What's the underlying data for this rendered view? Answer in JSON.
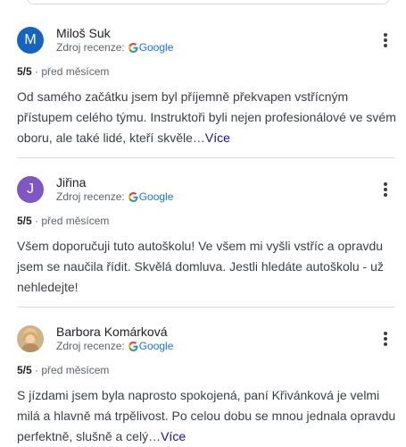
{
  "reviews": [
    {
      "name": "Miloš Suk",
      "avatar_letter": "M",
      "avatar_color": "#1565c0",
      "source_label": "Zdroj recenze:",
      "source_name": "Google",
      "rating": "5/5",
      "separator": "·",
      "time": "před měsícem",
      "text": "Od samého začátku jsem byl příjemně překvapen vstřícným přístupem celého týmu. Instruktoři byli nejen profesionálové ve svém oboru, ale také lidé, kteří skvěle…",
      "more": "Více"
    },
    {
      "name": "Jiřina",
      "avatar_letter": "J",
      "avatar_color": "#7e57c2",
      "source_label": "Zdroj recenze:",
      "source_name": "Google",
      "rating": "5/5",
      "separator": "·",
      "time": "před měsícem",
      "text": "Všem doporučuji tuto autoškolu! Ve všem mi vyšli vstříc a opravdu jsem se naučila řídit. Skvělá domluva. Jestli hledáte autoškolu - už nehledejte!"
    },
    {
      "name": "Barbora Komárková",
      "source_label": "Zdroj recenze:",
      "source_name": "Google",
      "rating": "5/5",
      "separator": "·",
      "time": "před měsícem",
      "text": "S jízdami jsem byla naprosto spokojená, paní Křivánková je velmi milá a hlavně má trpělivost. Po celou dobu se mnou jednala opravdu perfektně, slušně a celý…",
      "more": "Více"
    }
  ]
}
